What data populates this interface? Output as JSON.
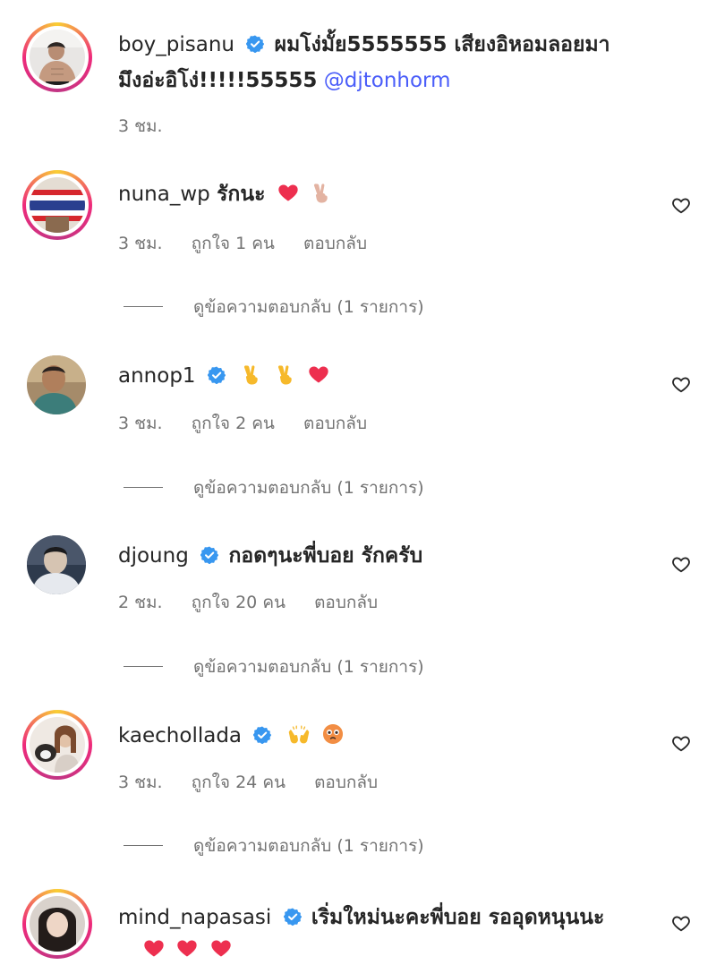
{
  "comments": [
    {
      "username": "boy_pisanu",
      "verified": true,
      "text_line1": "ผมโง่มั้ย5555555 เสียงอิหอมลอยมา",
      "text_line2": "มึงอ่ะอิโง่!!!!!55555",
      "mention": "@djtonhorm",
      "time": "3 ชม."
    },
    {
      "username": "nuna_wp",
      "verified": false,
      "text": "รักนะ",
      "emojis": [
        "red-heart",
        "victory-hand"
      ],
      "time": "3 ชม.",
      "likes": "ถูกใจ 1 คน",
      "reply_label": "ตอบกลับ",
      "view_replies": "ดูข้อความตอบกลับ (1 รายการ)"
    },
    {
      "username": "annop1",
      "verified": true,
      "text": "",
      "emojis": [
        "victory-hand",
        "victory-hand",
        "red-heart"
      ],
      "time": "3 ชม.",
      "likes": "ถูกใจ 2 คน",
      "reply_label": "ตอบกลับ",
      "view_replies": "ดูข้อความตอบกลับ (1 รายการ)"
    },
    {
      "username": "djoung",
      "verified": true,
      "text": "กอดๆนะพี่บอย รักครับ",
      "time": "2 ชม.",
      "likes": "ถูกใจ 20 คน",
      "reply_label": "ตอบกลับ",
      "view_replies": "ดูข้อความตอบกลับ (1 รายการ)"
    },
    {
      "username": "kaechollada",
      "verified": true,
      "text": "",
      "emojis": [
        "raising-hands",
        "flushed-face"
      ],
      "time": "3 ชม.",
      "likes": "ถูกใจ 24 คน",
      "reply_label": "ตอบกลับ",
      "view_replies": "ดูข้อความตอบกลับ (1 รายการ)"
    },
    {
      "username": "mind_napasasi",
      "verified": true,
      "text": "เริ่มใหม่นะคะพี่บอย รออุดหนุนนะ",
      "emojis": [
        "red-heart",
        "red-heart",
        "red-heart"
      ]
    }
  ],
  "colors": {
    "verified": "#3897f0",
    "mention": "#4a5df9",
    "meta": "#737373",
    "heart": "#ed2f4f"
  }
}
